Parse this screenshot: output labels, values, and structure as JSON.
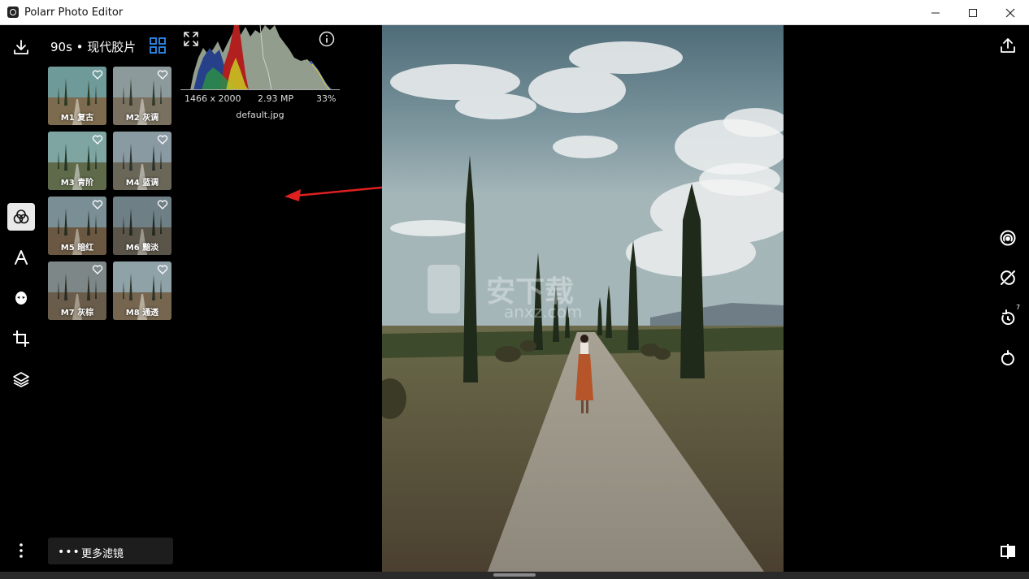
{
  "window": {
    "title": "Polarr Photo Editor",
    "controls": [
      "minimize-icon",
      "maximize-icon",
      "close-icon"
    ]
  },
  "left_toolbar": {
    "items": [
      {
        "icon": "download-icon"
      },
      {
        "icon": "filters-icon",
        "active": true
      },
      {
        "icon": "text-icon"
      },
      {
        "icon": "face-icon"
      },
      {
        "icon": "crop-icon"
      },
      {
        "icon": "layers-icon"
      },
      {
        "icon": "more-vertical-icon"
      }
    ]
  },
  "filters_panel": {
    "title": "90s • 现代胶片",
    "view_toggle_icon": "grid-icon",
    "filters": [
      {
        "label": "M1 复古"
      },
      {
        "label": "M2 灰调"
      },
      {
        "label": "M3 青阶"
      },
      {
        "label": "M4 蓝调"
      },
      {
        "label": "M5 暗红"
      },
      {
        "label": "M6 黯淡"
      },
      {
        "label": "M7 灰棕"
      },
      {
        "label": "M8 通透"
      }
    ],
    "more_filters": {
      "dots": "•••",
      "label": "更多滤镜"
    }
  },
  "image_info": {
    "dimensions": "1466 x 2000",
    "megapixels": "2.93 MP",
    "zoom": "33%",
    "file_name": "default.jpg",
    "expand_icon": "expand-icon",
    "info_icon": "info-icon"
  },
  "right_toolbar": {
    "items": [
      {
        "icon": "share-icon"
      },
      {
        "icon": "compare-icon"
      },
      {
        "icon": "hide-adjustments-icon"
      },
      {
        "icon": "history-icon",
        "badge": "7"
      },
      {
        "icon": "reset-icon"
      },
      {
        "icon": "split-view-icon"
      }
    ]
  },
  "colors": {
    "background": "#000000",
    "active_tool_bg": "#e9e9e9",
    "accent": "#2d8cf0",
    "arrow": "#e02020"
  }
}
